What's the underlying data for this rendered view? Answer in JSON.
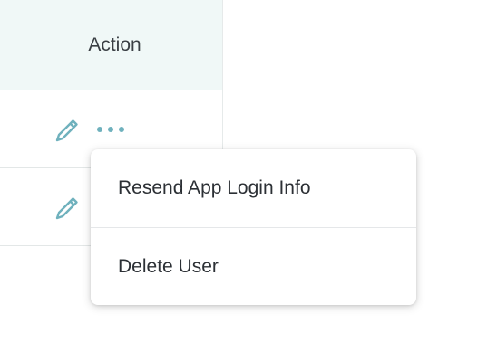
{
  "table": {
    "header": {
      "action_label": "Action"
    },
    "rows": [
      {
        "edit_icon": "pencil-icon",
        "more_icon": "ellipsis-icon"
      },
      {
        "edit_icon": "pencil-icon"
      }
    ]
  },
  "menu": {
    "items": [
      {
        "label": "Resend App Login Info"
      },
      {
        "label": "Delete User"
      }
    ]
  },
  "colors": {
    "header_bg": "#f0f8f7",
    "icon_teal": "#6fb1bd",
    "text": "#2c3035",
    "divider": "#e3e7e7"
  }
}
